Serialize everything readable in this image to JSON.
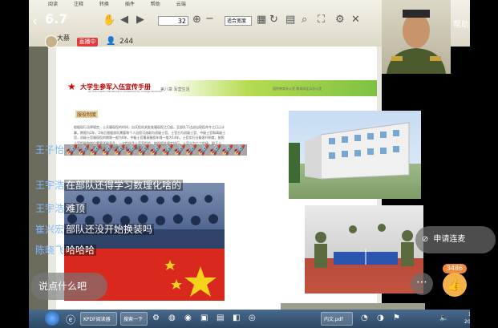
{
  "overlay": {
    "viewer_count": "6.7",
    "host_name": "大蔡",
    "live_label": "直播中",
    "viewer_num": "244",
    "help_label": "帮助",
    "input_placeholder": "说点什么吧",
    "mic_label": "申请连麦",
    "like_count": "3486"
  },
  "chat": [
    {
      "user": "王子怡",
      "text": "🚀🚀🚀🚀🚀🚀🚀🚀🚀🚀🚀🚀🚀🚀🚀"
    },
    {
      "user": "王宇浩",
      "text": "在部队还得学习数理化啥的"
    },
    {
      "user": "王宇浩",
      "text": "难顶"
    },
    {
      "user": "崔兴宏",
      "text": "部队还没开始换装吗"
    },
    {
      "user": "陈晓飞",
      "text": "哈哈哈"
    }
  ],
  "reader": {
    "menu": [
      "阅读",
      "注释",
      "转换",
      "插件",
      "帮助",
      "云端"
    ],
    "page_number": "32",
    "zoom": "适合宽度",
    "doc_title": "大学生参军入伍宣传手册",
    "doc_subtitle": "An Information Handbook on Enlistment for College Students",
    "chapter": "第八章 军营生活",
    "header_right": "国防教育办公室 教育局征兵办公室",
    "section_title": "服役制度",
    "body_text": "根据现行法律规定，士兵服现役的时间，自兵役机关批准服现役之日起，至部队下达退出现役命令之日止计算。期限为2年，2年后根据部队需要和个人自愿可选取为初级士官。士官分为初级士官、中级士官和高级士官，初级士官服现役的期限一般为6年，中级士官最高服役年限一般为14年。士官实行分级晋升制度，按照士官衔级和岗位需要逐级晋升，一次性授予士官军衔的，按照相关规定执行。士官分为六个衔级，即下士、中士、上士、四级军士长、三级军士长、二级军士长。"
  },
  "taskbar": {
    "apps": [
      "KPDF阅读器",
      "搜索一下",
      "内文.pdf"
    ],
    "time": "15:36",
    "date": "2020/6/7"
  },
  "colors": {
    "live_red": "#e23b3b",
    "chat_user": "#7fb8ff",
    "banner_green": "#7dc242",
    "flag_red": "#d9281e"
  }
}
